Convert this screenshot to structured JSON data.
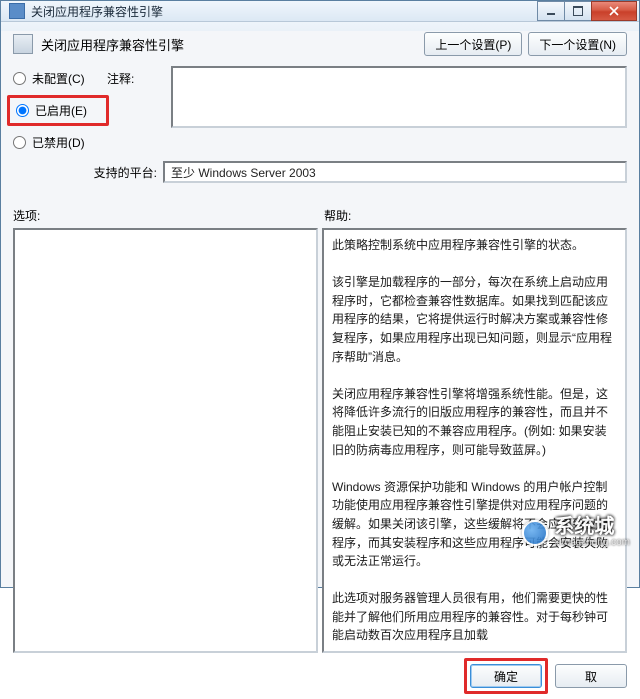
{
  "window": {
    "title": "关闭应用程序兼容性引擎"
  },
  "header": {
    "title": "关闭应用程序兼容性引擎",
    "prev_button": "上一个设置(P)",
    "next_button": "下一个设置(N)"
  },
  "radios": {
    "not_configured": "未配置(C)",
    "enabled": "已启用(E)",
    "disabled": "已禁用(D)",
    "selected": "enabled"
  },
  "labels": {
    "comment": "注释:",
    "platform": "支持的平台:",
    "options": "选项:",
    "help": "帮助:"
  },
  "fields": {
    "comment_value": "",
    "platform_value": "至少 Windows Server 2003"
  },
  "help_text": "此策略控制系统中应用程序兼容性引擎的状态。\n\n该引擎是加载程序的一部分，每次在系统上启动应用程序时，它都检查兼容性数据库。如果找到匹配该应用程序的结果，它将提供运行时解决方案或兼容性修复程序，如果应用程序出现已知问题，则显示“应用程序帮助”消息。\n\n关闭应用程序兼容性引擎将增强系统性能。但是，这将降低许多流行的旧版应用程序的兼容性，而且并不能阻止安装已知的不兼容应用程序。(例如: 如果安装旧的防病毒应用程序，则可能导致蓝屏。)\n\nWindows 资源保护功能和 Windows 的用户帐户控制功能使用应用程序兼容性引擎提供对应用程序问题的缓解。如果关闭该引擎，这些缓解将不会应用到应用程序，而其安装程序和这些应用程序可能会安装失败或无法正常运行。\n\n此选项对服务器管理人员很有用，他们需要更快的性能并了解他们所用应用程序的兼容性。对于每秒钟可能启动数百次应用程序且加载",
  "buttons": {
    "ok": "确定",
    "cancel": "取",
    "apply": ""
  },
  "watermark": {
    "brand": "系统城",
    "url": "xitongcheng.com"
  }
}
